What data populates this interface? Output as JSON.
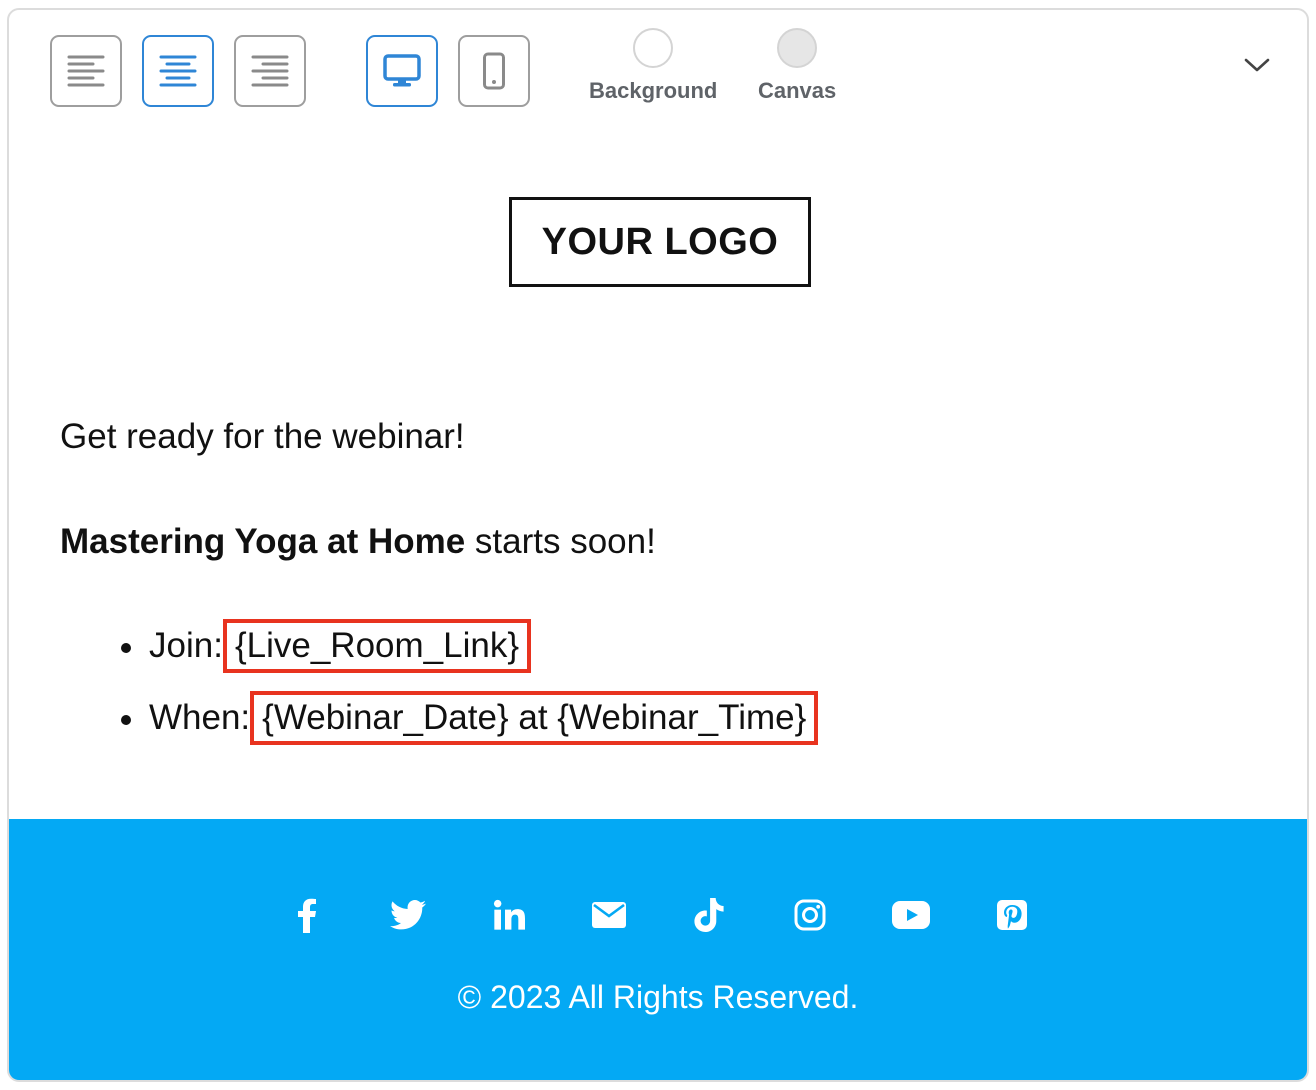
{
  "toolbar": {
    "align_buttons": [
      {
        "name": "align-left",
        "active": false
      },
      {
        "name": "align-center",
        "active": true
      },
      {
        "name": "align-right",
        "active": false
      }
    ],
    "view_buttons": [
      {
        "name": "desktop-view",
        "active": true
      },
      {
        "name": "mobile-view",
        "active": false
      }
    ],
    "background_label": "Background",
    "canvas_label": "Canvas",
    "colors": {
      "accent": "#2f86d6",
      "border": "#9e9e9e",
      "background_swatch": "#ffffff",
      "canvas_swatch": "#e6e6e6"
    }
  },
  "email": {
    "logo_text": "YOUR LOGO",
    "intro": "Get ready for the webinar!",
    "headline_bold": "Mastering Yoga at Home",
    "headline_rest": " starts soon!",
    "bullets": [
      {
        "label": "Join:",
        "tag": "{Live_Room_Link}"
      },
      {
        "label": "When:",
        "tag": "{Webinar_Date} at {Webinar_Time}"
      }
    ],
    "highlight_color": "#e8331f"
  },
  "footer": {
    "background": "#04a9f4",
    "social_icons": [
      "facebook-icon",
      "twitter-icon",
      "linkedin-icon",
      "email-icon",
      "tiktok-icon",
      "instagram-icon",
      "youtube-icon",
      "pinterest-icon"
    ],
    "copyright": "© 2023 All Rights Reserved."
  }
}
